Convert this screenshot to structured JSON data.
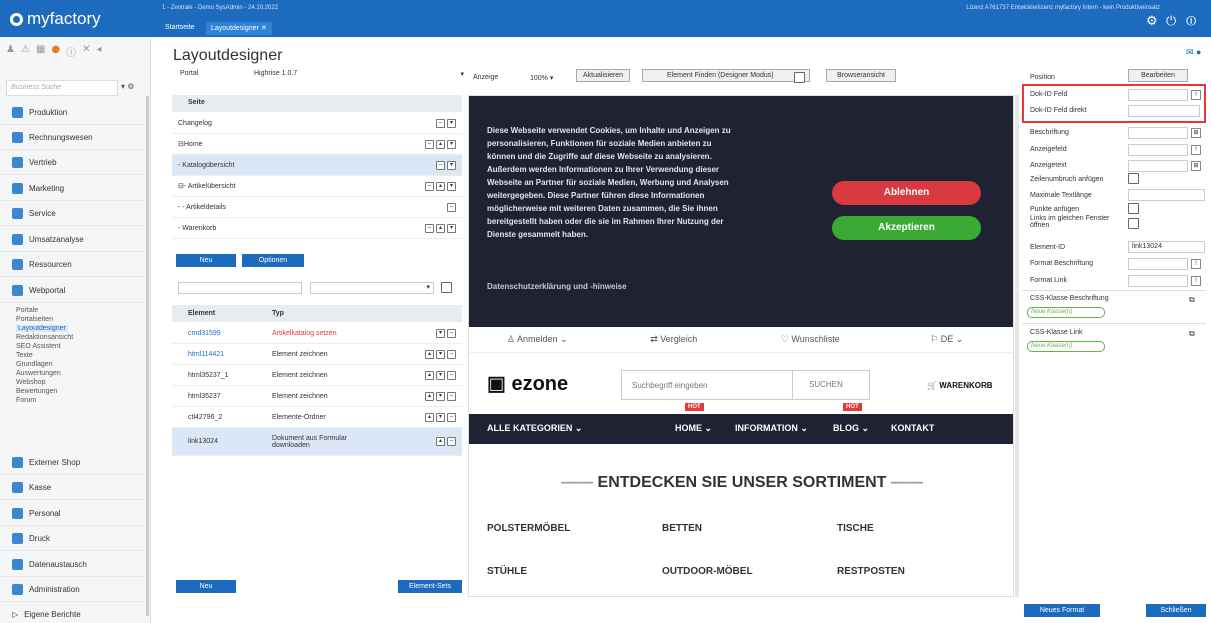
{
  "app": {
    "logo": "myfactory",
    "sysinfo": "1 - Zentrale - Demo SysAdmin - 24.10.2022",
    "license": "Lizenz A761737 Entwicklerlizenz myfactory Intern - kein Produktiveinsatz"
  },
  "tabs": [
    {
      "label": "Startseite"
    },
    {
      "label": "Layoutdesigner"
    }
  ],
  "sidebar": {
    "search_placeholder": "Business Suche",
    "items": [
      "Produktion",
      "Rechnungswesen",
      "Vertrieb",
      "Marketing",
      "Service",
      "Umsatzanalyse",
      "Ressourcen",
      "Webportal",
      "Externer Shop",
      "Kasse",
      "Personal",
      "Druck",
      "Datenaustausch",
      "Administration",
      "Eigene Berichte"
    ],
    "sub": [
      "Portale",
      "Portalseiten",
      "Layoutdesigner",
      "Redaktionsansicht",
      "SEO Assistent",
      "Texte",
      "Grundlagen",
      "Auswertungen",
      "Webshop",
      "Bewertungen",
      "Forum"
    ]
  },
  "title": "Layoutdesigner",
  "toolbar": {
    "portal_label": "Portal",
    "portal_value": "Highrise 1.0.7",
    "anzeige_label": "Anzeige",
    "zoom": "100%",
    "refresh": "Aktualisieren",
    "find": "Element Finden (Designer Modus)",
    "browser": "Browseransicht"
  },
  "pages": {
    "header": "Seite",
    "rows": [
      "Changelog",
      "Home",
      "- Katalogübersicht",
      "- Artikelübersicht",
      "- - Artikeldetails",
      "- Warenkorb"
    ]
  },
  "buttons": {
    "neu": "Neu",
    "optionen": "Optionen",
    "neu2": "Neu",
    "elementsets": "Element-Sets",
    "neues_format": "Neues Format",
    "schliessen": "Schließen",
    "bearbeiten": "Bearbeiten"
  },
  "elements": {
    "h1": "Element",
    "h2": "Typ",
    "rows": [
      {
        "el": "cmd31599",
        "typ": "Artikelkatalog setzen"
      },
      {
        "el": "html114421",
        "typ": "Element zeichnen"
      },
      {
        "el": "html35237_1",
        "typ": "Element zeichnen"
      },
      {
        "el": "html35237",
        "typ": "Element zeichnen"
      },
      {
        "el": "ctl42796_2",
        "typ": "Elemente-Ordner"
      },
      {
        "el": "link13024",
        "typ": "Dokument aus Formular downloaden"
      }
    ]
  },
  "preview": {
    "cookie_text": "Diese Webseite verwendet Cookies, um Inhalte und Anzeigen zu personalisieren, Funktionen für soziale Medien anbieten zu können und die Zugriffe auf diese Webseite zu analysieren. Außerdem werden Informationen zu Ihrer Verwendung dieser Webseite an Partner für soziale Medien, Werbung und Analysen weitergegeben. Diese Partner führen diese Informationen möglicherweise mit weiteren Daten zusammen, die Sie ihnen bereitgestellt haben oder die sie im Rahmen Ihrer Nutzung der Dienste gesammelt haben.",
    "cookie_link": "Datenschutzerklärung und -hinweise",
    "ablehnen": "Ablehnen",
    "akzeptieren": "Akzeptieren",
    "anmelden": "Anmelden",
    "vergleich": "Vergleich",
    "wunschliste": "Wunschliste",
    "lang": "DE",
    "shopname": "ezone",
    "search": "Suchbegriff eingeben",
    "suchen": "SUCHEN",
    "warenkorb": "WARENKORB",
    "alle": "ALLE KATEGORIEN",
    "home": "HOME",
    "information": "INFORMATION",
    "blog": "BLOG",
    "kontakt": "KONTAKT",
    "hot": "HOT",
    "headline": "ENTDECKEN SIE UNSER SORTIMENT",
    "cats": [
      "POLSTERMÖBEL",
      "BETTEN",
      "TISCHE",
      "STÜHLE",
      "OUTDOOR-MÖBEL",
      "RESTPOSTEN"
    ]
  },
  "props": {
    "position": "Position",
    "dokid": "Dok-ID Feld",
    "dokid_direkt": "Dok-ID Feld direkt",
    "beschriftung": "Beschriftung",
    "anzeigefeld": "Anzeigefeld",
    "anzeigetext": "Anzeigetext",
    "zeilenumbruch": "Zeilenumbruch anfügen",
    "maxlen": "Maximale Textlänge",
    "punkte": "Punkte anfügen",
    "links_gleich": "Links im gleichen Fenster öffnen",
    "elementid": "Element-ID",
    "elementid_value": "link13024",
    "format_beschriftung": "Format Beschriftung",
    "format_link": "Format Link",
    "css_beschriftung": "CSS-Klasse Beschriftung",
    "css_link": "CSS-Klasse Link",
    "neue_klasse": "Neue Klasse(n)"
  }
}
